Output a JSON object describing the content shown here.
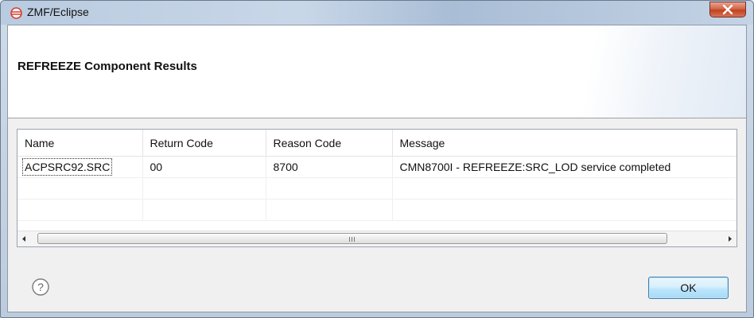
{
  "window": {
    "title": "ZMF/Eclipse"
  },
  "dialog": {
    "title": "REFREEZE Component Results"
  },
  "table": {
    "columns": [
      "Name",
      "Return Code",
      "Reason Code",
      "Message"
    ],
    "rows": [
      [
        "ACPSRC92.SRC",
        "00",
        "8700",
        "CMN8700I - REFREEZE:SRC_LOD  service completed"
      ]
    ]
  },
  "buttons": {
    "ok": "OK"
  },
  "colors": {
    "app_icon": "#d63a2f",
    "close_button": "#c8482a",
    "ok_border": "#3c7fb1"
  },
  "icons": {
    "app": "eclipse-icon",
    "close": "close-icon",
    "help": "help-icon"
  }
}
